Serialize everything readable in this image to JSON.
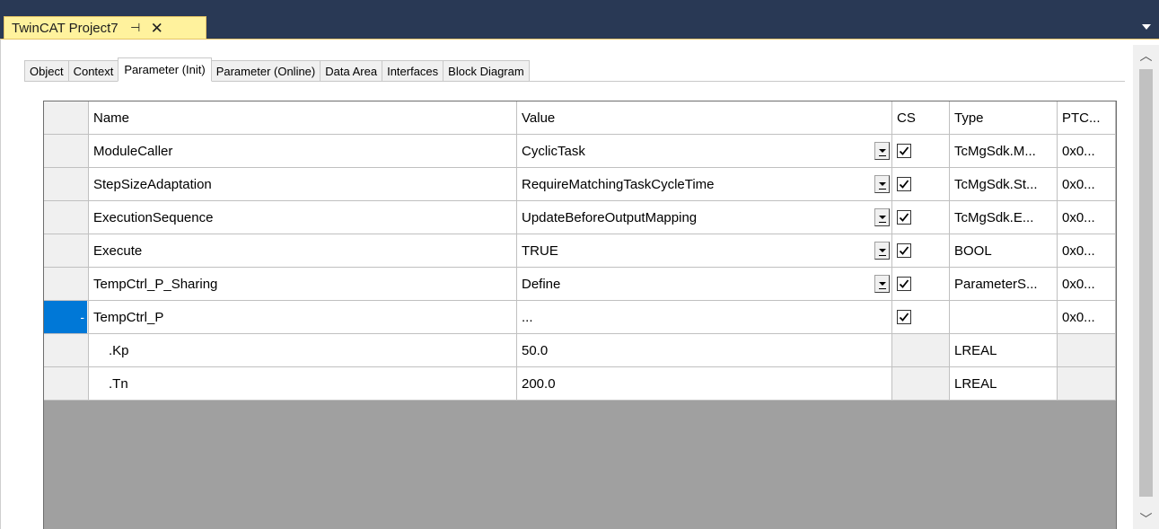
{
  "document_tab": {
    "title": "TwinCAT Project7",
    "pin_icon": "pin-icon",
    "close_icon": "close-icon"
  },
  "property_tabs": [
    {
      "label": "Object"
    },
    {
      "label": "Context"
    },
    {
      "label": "Parameter (Init)",
      "active": true
    },
    {
      "label": "Parameter (Online)"
    },
    {
      "label": "Data Area"
    },
    {
      "label": "Interfaces"
    },
    {
      "label": "Block Diagram"
    }
  ],
  "grid": {
    "columns": {
      "name": "Name",
      "value": "Value",
      "cs": "CS",
      "type": "Type",
      "ptc": "PTC..."
    },
    "rows": [
      {
        "name": "ModuleCaller",
        "value": "CyclicTask",
        "dropdown": true,
        "cs": true,
        "type": "TcMgSdk.M...",
        "ptc": "0x0..."
      },
      {
        "name": "StepSizeAdaptation",
        "value": "RequireMatchingTaskCycleTime",
        "dropdown": true,
        "cs": true,
        "type": "TcMgSdk.St...",
        "ptc": "0x0..."
      },
      {
        "name": "ExecutionSequence",
        "value": "UpdateBeforeOutputMapping",
        "dropdown": true,
        "cs": true,
        "type": "TcMgSdk.E...",
        "ptc": "0x0..."
      },
      {
        "name": "Execute",
        "value": "TRUE",
        "dropdown": true,
        "cs": true,
        "type": "BOOL",
        "ptc": "0x0..."
      },
      {
        "name": "TempCtrl_P_Sharing",
        "value": "Define",
        "dropdown": true,
        "cs": true,
        "type": "ParameterS...",
        "ptc": "0x0..."
      },
      {
        "name": "TempCtrl_P",
        "value": "...",
        "dropdown": false,
        "cs": true,
        "type": "",
        "ptc": "0x0...",
        "selected": true,
        "expander": "-"
      },
      {
        "name": ".Kp",
        "value": "50.0",
        "dropdown": false,
        "cs": null,
        "type": "LREAL",
        "ptc": "",
        "indent": true
      },
      {
        "name": ".Tn",
        "value": "200.0",
        "dropdown": false,
        "cs": null,
        "type": "LREAL",
        "ptc": "",
        "indent": true
      }
    ]
  }
}
